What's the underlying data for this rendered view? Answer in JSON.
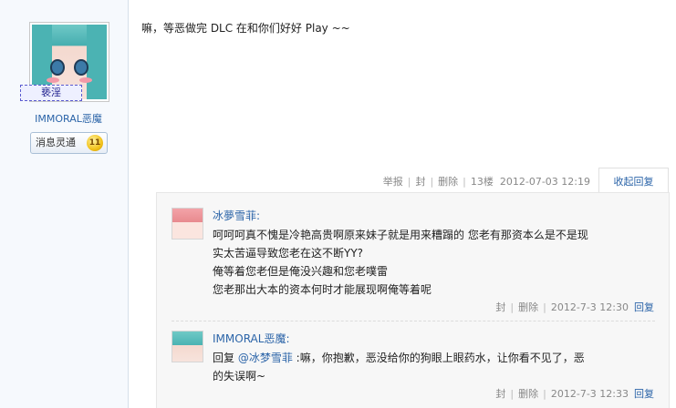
{
  "user": {
    "nickname_badge": "亵淫",
    "username": "IMMORAL恶魔",
    "medal_label": "消息灵通",
    "medal_count": "11"
  },
  "post": {
    "text": "嘛，等恶做完 DLC 在和你们好好 Play ~~",
    "meta": {
      "report": "举报",
      "block": "封",
      "delete": "删除",
      "floor": "13楼",
      "time": "2012-07-03 12:19"
    },
    "collapse_reply": "收起回复"
  },
  "replies": [
    {
      "author": "冰夢雪菲:",
      "lines": [
        "呵呵呵真不愧是冷艳高贵啊原来妹子就是用来糟蹋的 您老有那资本么是不是现",
        "实太苦逼导致您老在这不断YY?",
        "俺等着您老但是俺没兴趣和您老噗雷",
        "您老那出大本的资本何时才能展现啊俺等着呢"
      ],
      "meta": {
        "block": "封",
        "delete": "删除",
        "time": "2012-7-3 12:30",
        "reply": "回复"
      }
    },
    {
      "author": "IMMORAL恶魔:",
      "reply_prefix": "回复 ",
      "mention": "@冰梦雪菲",
      "text_line1": " :嘛，你抱歉，恶没给你的狗眼上眼药水，让你看不见了，恶",
      "text_line2": "的失误啊~",
      "meta": {
        "block": "封",
        "delete": "删除",
        "time": "2012-7-3 12:33",
        "reply": "回复"
      }
    }
  ],
  "colors": {
    "link": "#2b64a8",
    "sidebar_bg": "#f6f9fd",
    "reply_bg": "#f7f7f7"
  }
}
